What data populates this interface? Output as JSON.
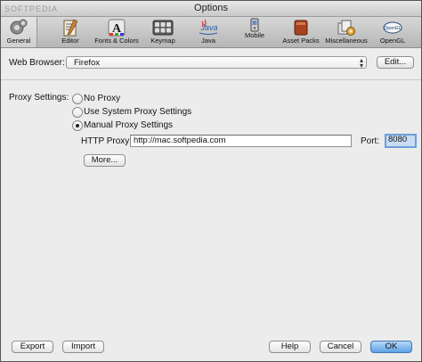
{
  "window": {
    "title": "Options",
    "watermark": "SOFTPEDIA"
  },
  "toolbar": {
    "items": [
      {
        "label": "General",
        "icon": "general-icon"
      },
      {
        "label": "Editor",
        "icon": "editor-icon"
      },
      {
        "label": "Fonts & Colors",
        "icon": "fonts-colors-icon"
      },
      {
        "label": "Keymap",
        "icon": "keymap-icon"
      },
      {
        "label": "Java",
        "icon": "java-icon"
      },
      {
        "label": "Mobile",
        "icon": "mobile-icon"
      },
      {
        "label": "Asset Packs",
        "icon": "asset-packs-icon"
      },
      {
        "label": "Miscellaneous",
        "icon": "miscellaneous-icon"
      },
      {
        "label": "OpenGL",
        "icon": "opengl-icon"
      }
    ],
    "selected": "General",
    "java_logo_text": "Java",
    "opengl_logo_text": "OpenGL"
  },
  "web_browser": {
    "label": "Web Browser:",
    "value": "Firefox",
    "edit_label": "Edit..."
  },
  "proxy": {
    "label": "Proxy Settings:",
    "options": [
      {
        "label": "No Proxy",
        "selected": false
      },
      {
        "label": "Use System Proxy Settings",
        "selected": false
      },
      {
        "label": "Manual Proxy Settings",
        "selected": true
      }
    ],
    "http_proxy_label": "HTTP Proxy:",
    "http_proxy_value": "http://mac.softpedia.com",
    "port_label": "Port:",
    "port_value": "8080",
    "more_label": "More..."
  },
  "footer": {
    "export_label": "Export",
    "import_label": "Import",
    "help_label": "Help",
    "cancel_label": "Cancel",
    "ok_label": "OK"
  }
}
